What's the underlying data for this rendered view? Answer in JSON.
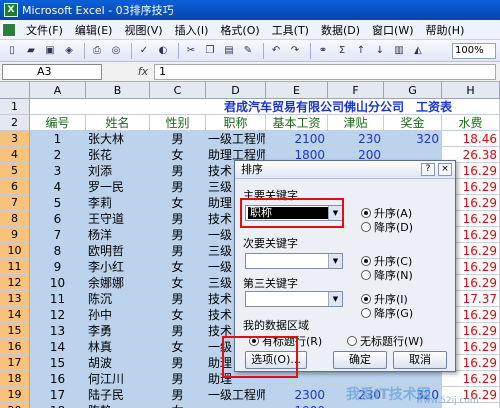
{
  "window": {
    "title": "Microsoft Excel - 03排序技巧",
    "app_badge": "X"
  },
  "menu": [
    "文件(F)",
    "编辑(E)",
    "视图(V)",
    "插入(I)",
    "格式(O)",
    "工具(T)",
    "数据(D)",
    "窗口(W)",
    "帮助(H)"
  ],
  "toolbar": {
    "zoom": "100%"
  },
  "formula": {
    "cell_ref": "A3",
    "fx": "fx",
    "value": "1"
  },
  "columns": [
    "A",
    "B",
    "C",
    "D",
    "E",
    "F",
    "G",
    "H"
  ],
  "sheet": {
    "title": "君成汽车贸易有限公司佛山分公司　工资表",
    "headers": [
      "编号",
      "姓名",
      "性别",
      "职称",
      "基本工资",
      "津贴",
      "奖金",
      "水费"
    ],
    "rows": [
      {
        "r": "3",
        "a": "1",
        "b": "张大林",
        "c": "男",
        "d": "一级工程师",
        "e": "2100",
        "f": "230",
        "g": "320",
        "h": "18.46"
      },
      {
        "r": "4",
        "a": "2",
        "b": "张花",
        "c": "女",
        "d": "助理工程师",
        "e": "1800",
        "f": "200",
        "g": "",
        "h": "26.38"
      },
      {
        "r": "5",
        "a": "3",
        "b": "刘添",
        "c": "男",
        "d": "技术",
        "e": "",
        "f": "",
        "g": "",
        "h": "16.29"
      },
      {
        "r": "6",
        "a": "4",
        "b": "罗一民",
        "c": "男",
        "d": "三级",
        "e": "",
        "f": "",
        "g": "",
        "h": "16.29"
      },
      {
        "r": "7",
        "a": "5",
        "b": "李莉",
        "c": "女",
        "d": "助理",
        "e": "",
        "f": "",
        "g": "",
        "h": "16.29"
      },
      {
        "r": "8",
        "a": "6",
        "b": "王守道",
        "c": "男",
        "d": "技术",
        "e": "",
        "f": "",
        "g": "",
        "h": "16.29"
      },
      {
        "r": "9",
        "a": "7",
        "b": "杨洋",
        "c": "男",
        "d": "一级",
        "e": "",
        "f": "",
        "g": "",
        "h": "16.29"
      },
      {
        "r": "10",
        "a": "8",
        "b": "欧明哲",
        "c": "男",
        "d": "三级",
        "e": "",
        "f": "",
        "g": "",
        "h": "16.29"
      },
      {
        "r": "11",
        "a": "9",
        "b": "李小红",
        "c": "女",
        "d": "一级",
        "e": "",
        "f": "",
        "g": "",
        "h": "16.29"
      },
      {
        "r": "12",
        "a": "10",
        "b": "余娜娜",
        "c": "女",
        "d": "三级",
        "e": "",
        "f": "",
        "g": "",
        "h": "16.29"
      },
      {
        "r": "13",
        "a": "11",
        "b": "陈沉",
        "c": "男",
        "d": "技术",
        "e": "",
        "f": "",
        "g": "",
        "h": "17.37"
      },
      {
        "r": "14",
        "a": "12",
        "b": "孙中",
        "c": "女",
        "d": "技术",
        "e": "",
        "f": "",
        "g": "",
        "h": "16.29"
      },
      {
        "r": "15",
        "a": "13",
        "b": "李勇",
        "c": "男",
        "d": "技术",
        "e": "",
        "f": "",
        "g": "",
        "h": "16.29"
      },
      {
        "r": "16",
        "a": "14",
        "b": "林真",
        "c": "女",
        "d": "一级",
        "e": "",
        "f": "",
        "g": "",
        "h": "16.29"
      },
      {
        "r": "17",
        "a": "15",
        "b": "胡波",
        "c": "男",
        "d": "助理",
        "e": "",
        "f": "",
        "g": "",
        "h": "16.29"
      },
      {
        "r": "18",
        "a": "16",
        "b": "何江川",
        "c": "男",
        "d": "助理",
        "e": "",
        "f": "",
        "g": "",
        "h": "16.29"
      },
      {
        "r": "19",
        "a": "17",
        "b": "陆子民",
        "c": "男",
        "d": "一级工程师",
        "e": "2300",
        "f": "230",
        "g": "320",
        "h": "16.29"
      },
      {
        "r": "20",
        "a": "18",
        "b": "陈静",
        "c": "女",
        "d": "",
        "e": "1900",
        "f": "",
        "g": "",
        "h": ""
      }
    ]
  },
  "dialog": {
    "title": "排序",
    "help": "?",
    "close": "×",
    "key1_label": "主要关键字",
    "key1_value": "职称",
    "key2_label": "次要关键字",
    "key3_label": "第三关键字",
    "asc": "升序(A)",
    "desc": "降序(D)",
    "asc2": "升序(C)",
    "desc2": "降序(N)",
    "asc3": "升序(I)",
    "desc3": "降序(G)",
    "range_label": "我的数据区域",
    "has_header": "有标题行(R)",
    "no_header": "无标题行(W)",
    "options": "选项(O)...",
    "ok": "确定",
    "cancel": "取消"
  },
  "watermark": {
    "main": "我爱IT技术网",
    "sub": "www.52ij.com"
  },
  "colors": {
    "accent": "#0a5fd8",
    "selection": "#bcd3ee",
    "highlight": "#e01010"
  }
}
